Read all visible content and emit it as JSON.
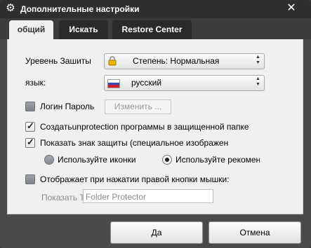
{
  "window": {
    "title": "Дополнительные настройки"
  },
  "tabs": [
    {
      "label": "общий"
    },
    {
      "label": "Искать"
    },
    {
      "label": "Restore Center"
    }
  ],
  "protection": {
    "label": "Уревень Зашиты",
    "value": "Степень: Нормальная"
  },
  "language": {
    "label": "язык:",
    "value": "русский"
  },
  "login": {
    "label": "Логин Пароль",
    "change_button": "Изменить ...",
    "checked": false
  },
  "create_in_folder": {
    "label": "Создатьunprotection программы в защищенной папке",
    "checked": true
  },
  "show_badge": {
    "label": "Показать знак защиты (специальное изображен",
    "checked": true
  },
  "icon_options": {
    "use_icons": "Используйте иконки",
    "use_recommended": "Используйте рекоменду",
    "selected": "use_recommended"
  },
  "context_menu": {
    "label": "Отображает при нажатии правой кнопки мышки:",
    "checked": false
  },
  "show_text": {
    "label": "Показать Те",
    "value": "Folder Protector"
  },
  "buttons": {
    "ok": "Да",
    "cancel": "Отмена"
  }
}
